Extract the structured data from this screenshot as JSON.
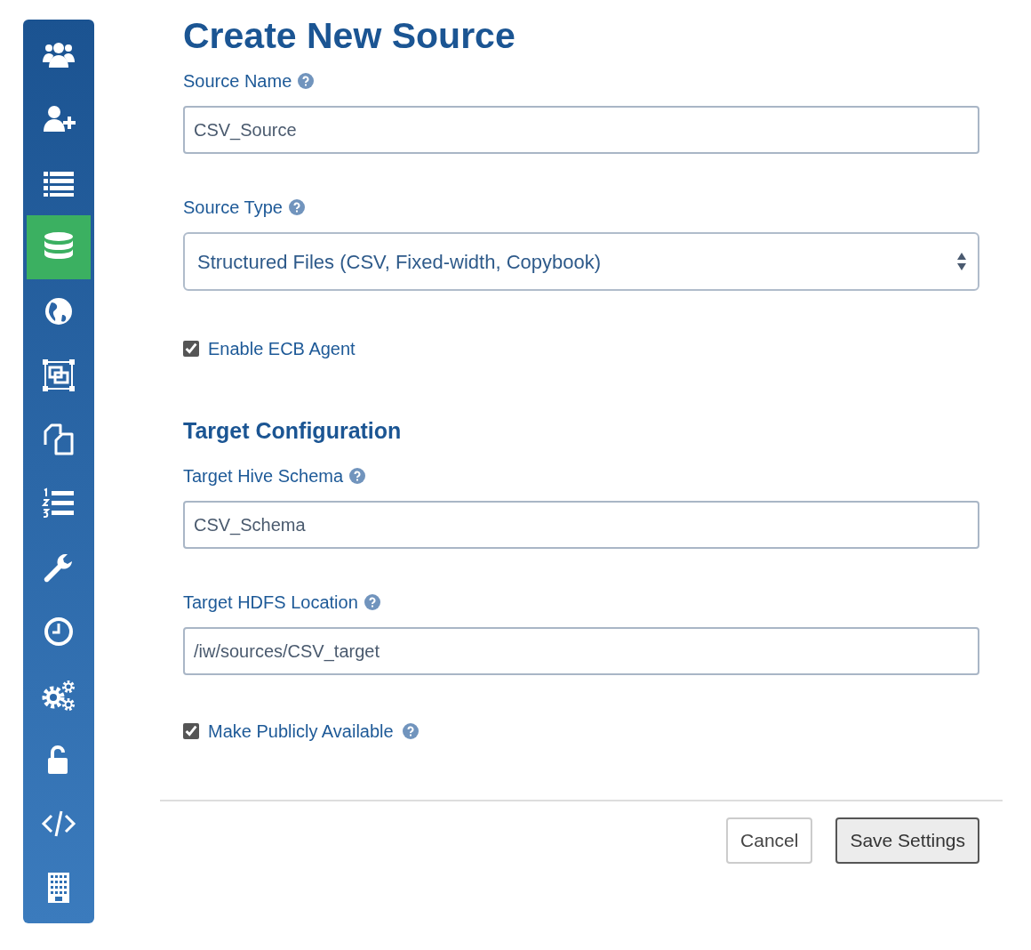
{
  "sidebar": {
    "items": [
      {
        "kind": "users",
        "selected": false
      },
      {
        "kind": "user-add",
        "selected": false
      },
      {
        "kind": "list",
        "selected": false
      },
      {
        "kind": "database",
        "selected": true
      },
      {
        "kind": "globe",
        "selected": false
      },
      {
        "kind": "frames",
        "selected": false
      },
      {
        "kind": "copy",
        "selected": false
      },
      {
        "kind": "numbered-list",
        "selected": false
      },
      {
        "kind": "wrench",
        "selected": false
      },
      {
        "kind": "clock",
        "selected": false
      },
      {
        "kind": "gears",
        "selected": false
      },
      {
        "kind": "unlock",
        "selected": false
      },
      {
        "kind": "code",
        "selected": false
      },
      {
        "kind": "building",
        "selected": false
      }
    ]
  },
  "title": "Create New Source",
  "fields": [
    {
      "kind": "text",
      "label": "Source Name",
      "help": true,
      "value": "CSV_Source"
    },
    {
      "kind": "select",
      "label": "Source Type",
      "help": true,
      "value": "Structured Files (CSV, Fixed-width, Copybook)"
    },
    {
      "kind": "checkbox",
      "label": "Enable ECB Agent",
      "help": false,
      "checked": true
    },
    {
      "kind": "heading",
      "label": "Target Configuration"
    },
    {
      "kind": "text",
      "label": "Target Hive Schema",
      "help": true,
      "value": "CSV_Schema"
    },
    {
      "kind": "text",
      "label": "Target HDFS Location",
      "help": true,
      "value": "/iw/sources/CSV_target"
    },
    {
      "kind": "checkbox",
      "label": "Make Publicly Available",
      "help": true,
      "checked": true
    }
  ],
  "buttons": [
    {
      "label": "Cancel",
      "kind": "secondary"
    },
    {
      "label": "Save Settings",
      "kind": "primary"
    }
  ]
}
